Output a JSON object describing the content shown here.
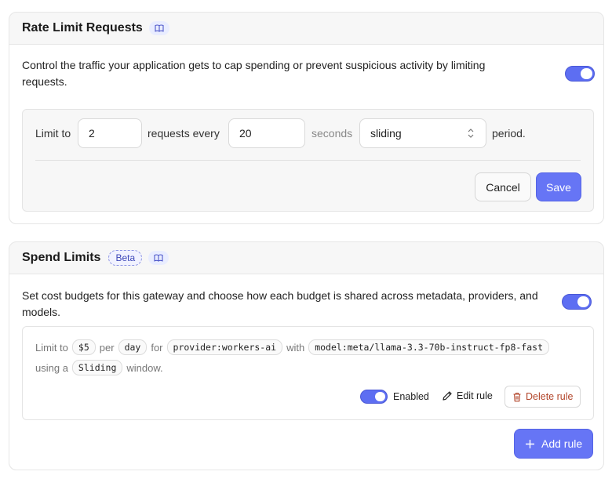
{
  "rate_limit": {
    "title": "Rate Limit Requests",
    "description": "Control the traffic your application gets to cap spending or prevent suspicious activity by limiting requests.",
    "enabled": true,
    "limit_to_label": "Limit to",
    "requests_value": "2",
    "requests_every_label": "requests every",
    "seconds_value": "20",
    "seconds_label": "seconds",
    "period_type": "sliding",
    "period_label": "period.",
    "cancel_label": "Cancel",
    "save_label": "Save"
  },
  "spend_limits": {
    "title": "Spend Limits",
    "badge": "Beta",
    "description": "Set cost budgets for this gateway and choose how each budget is shared across metadata, providers, and models.",
    "enabled": true,
    "rule": {
      "limit_to_label": "Limit to",
      "amount": "$5",
      "per_label": "per",
      "period": "day",
      "for_label": "for",
      "provider": "provider:workers-ai",
      "with_label": "with",
      "model": "model:meta/llama-3.3-70b-instruct-fp8-fast",
      "using_a_label": "using a",
      "window_type": "Sliding",
      "window_label": "window.",
      "enabled_label": "Enabled",
      "rule_enabled": true,
      "edit_label": "Edit rule",
      "delete_label": "Delete rule"
    },
    "add_rule_label": "Add rule"
  },
  "colors": {
    "accent": "#6675f5",
    "danger": "#b2452a"
  },
  "icons": [
    "book-icon",
    "chevron-updown-icon",
    "pencil-icon",
    "trash-icon",
    "plus-icon"
  ]
}
